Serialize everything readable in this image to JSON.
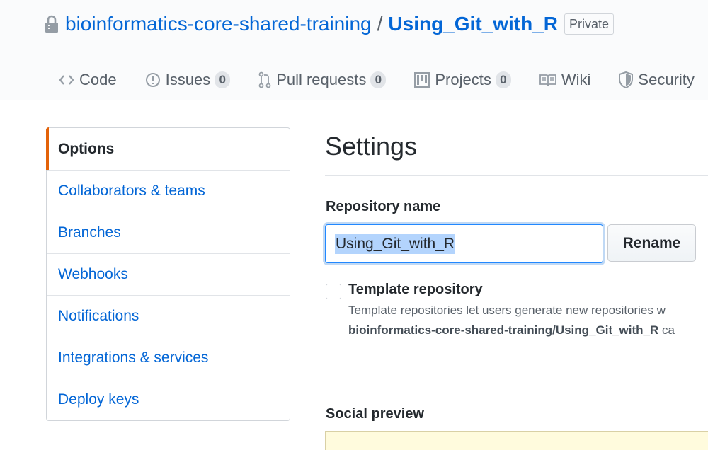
{
  "repo": {
    "owner": "bioinformatics-core-shared-training",
    "separator": "/",
    "name": "Using_Git_with_R",
    "visibility": "Private"
  },
  "tabs": [
    {
      "label": "Code",
      "icon": "code-icon"
    },
    {
      "label": "Issues",
      "count": "0",
      "icon": "issue-icon"
    },
    {
      "label": "Pull requests",
      "count": "0",
      "icon": "pull-request-icon"
    },
    {
      "label": "Projects",
      "count": "0",
      "icon": "project-icon"
    },
    {
      "label": "Wiki",
      "icon": "book-icon"
    },
    {
      "label": "Security",
      "icon": "shield-icon"
    }
  ],
  "menu": {
    "items": [
      {
        "label": "Options",
        "selected": true
      },
      {
        "label": "Collaborators & teams"
      },
      {
        "label": "Branches"
      },
      {
        "label": "Webhooks"
      },
      {
        "label": "Notifications"
      },
      {
        "label": "Integrations & services"
      },
      {
        "label": "Deploy keys"
      }
    ]
  },
  "main": {
    "title": "Settings",
    "repo_name_label": "Repository name",
    "repo_name_value": "Using_Git_with_R",
    "rename_label": "Rename",
    "template_label": "Template repository",
    "template_desc_line1": "Template repositories let users generate new repositories w",
    "template_desc_line2_bold": "bioinformatics-core-shared-training/Using_Git_with_R",
    "template_desc_line2_rest": " ca",
    "social_preview_label": "Social preview"
  },
  "colors": {
    "link": "#0366d6",
    "selected_accent": "#e36209",
    "social_box": "#fffbdd"
  }
}
